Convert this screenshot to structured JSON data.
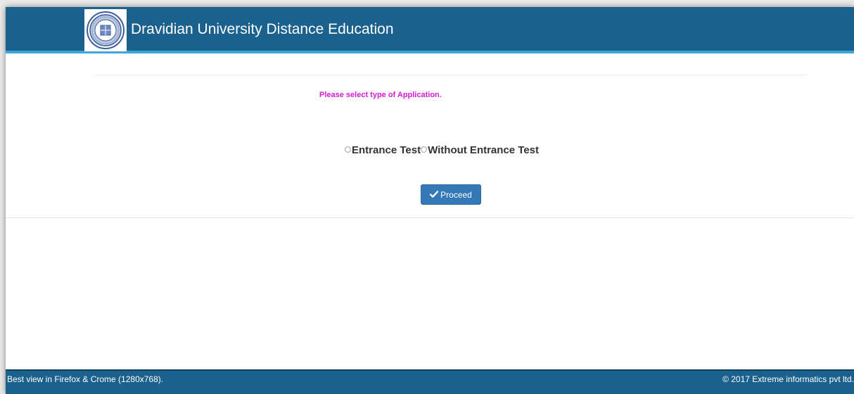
{
  "header": {
    "title": "Dravidian University Distance Education",
    "logo_icon": "university-seal-icon"
  },
  "main": {
    "prompt": "Please select type of Application.",
    "options": [
      {
        "label": "Entrance Test",
        "selected": false
      },
      {
        "label": "Without Entrance Test",
        "selected": false
      }
    ],
    "proceed_label": "Proceed",
    "proceed_icon": "checkmark-icon"
  },
  "footer": {
    "left_text": "Best view in Firefox & Crome (1280x768).",
    "right_text": "© 2017 Extreme informatics pvt ltd."
  },
  "colors": {
    "header_bg": "#1b618d",
    "header_accent": "#3fa6dd",
    "prompt_text": "#d61bd6",
    "button_bg": "#3479b7"
  }
}
